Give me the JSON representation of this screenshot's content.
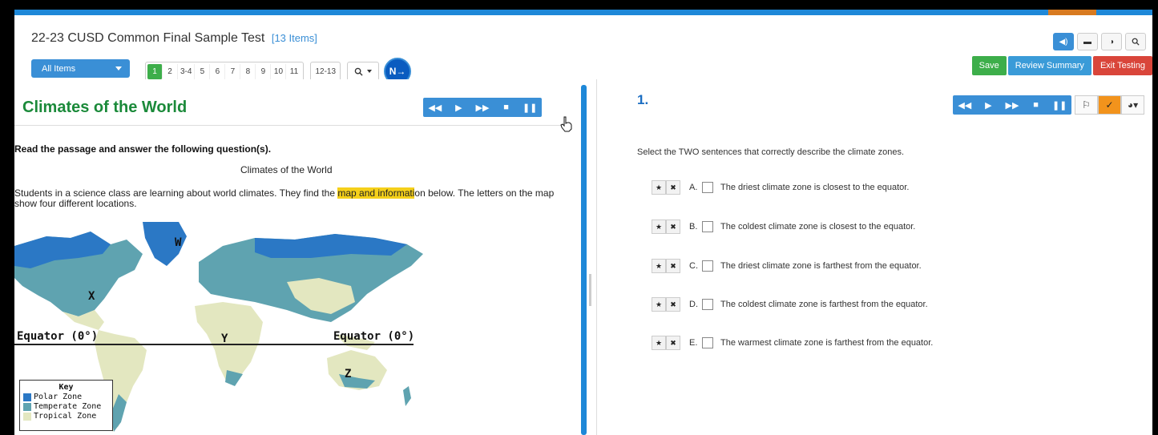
{
  "header": {
    "title": "22-23 CUSD Common Final Sample Test",
    "item_count": "[13 Items]",
    "all_items_label": "All Items",
    "pages": [
      "1",
      "2",
      "3-4",
      "5",
      "6",
      "7",
      "8",
      "9",
      "10",
      "11"
    ],
    "pages_group2": [
      "12-13"
    ],
    "next_label": "N→",
    "save_label": "Save",
    "review_label": "Review Summary",
    "exit_label": "Exit Testing"
  },
  "passage": {
    "title": "Climates of the World",
    "instructions": "Read the passage and answer the following question(s).",
    "heading": "Climates of the World",
    "body_before": "Students in a science class are learning about world climates. They find the ",
    "body_highlight": "map and informati",
    "body_after": "on below.  The letters on the map show four different locations."
  },
  "map": {
    "labels": {
      "w": "W",
      "x": "X",
      "y": "Y",
      "z": "Z",
      "equator_left": "Equator (0°)",
      "equator_right": "Equator (0°)"
    },
    "key_title": "Key",
    "key_items": [
      {
        "label": "Polar Zone",
        "color": "#2b78c5"
      },
      {
        "label": "Temperate Zone",
        "color": "#5fa3b0"
      },
      {
        "label": "Tropical Zone",
        "color": "#e3e7c0"
      }
    ]
  },
  "question": {
    "number": "1.",
    "prompt": "Select the TWO sentences that correctly describe the climate zones.",
    "options": [
      {
        "letter": "A.",
        "text": "The driest climate zone is closest to the equator."
      },
      {
        "letter": "B.",
        "text": "The coldest climate zone is closest to the equator."
      },
      {
        "letter": "C.",
        "text": "The driest climate zone is farthest from the equator."
      },
      {
        "letter": "D.",
        "text": "The coldest climate zone is farthest from the equator."
      },
      {
        "letter": "E.",
        "text": "The warmest climate zone is farthest from the equator."
      }
    ]
  },
  "colors": {
    "accent_blue": "#3a8fd6",
    "title_green": "#1b8a3a",
    "save_green": "#3dae4a",
    "exit_red": "#d9453a",
    "highlight": "#f5d01a",
    "mark_orange": "#f2931c"
  }
}
